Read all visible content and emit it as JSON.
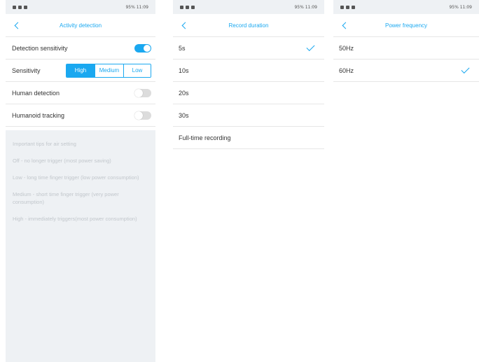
{
  "status_bar": {
    "right_text": "95% 11:09"
  },
  "screen1": {
    "title": "Activity detection",
    "rows": {
      "detection_sensitivity": "Detection sensitivity",
      "sensitivity": "Sensitivity",
      "human_detection": "Human detection",
      "humanoid_tracking": "Humanoid tracking"
    },
    "sensitivity_options": [
      "High",
      "Medium",
      "Low"
    ],
    "selected_sensitivity": "High",
    "toggles": {
      "detection_sensitivity": true,
      "human_detection": false,
      "humanoid_tracking": false
    },
    "tips": [
      "Important tips for air setting",
      "Off - no longer trigger (most power saving)",
      "Low - long time finger trigger (low power consumption)",
      "Medium - short time finger trigger (very power consumption)",
      "High - immediately triggers(most power consumption)"
    ]
  },
  "screen2": {
    "title": "Record duration",
    "options": [
      "5s",
      "10s",
      "20s",
      "30s",
      "Full-time recording"
    ],
    "selected": "5s"
  },
  "screen3": {
    "title": "Power frequency",
    "options": [
      "50Hz",
      "60Hz"
    ],
    "selected": "60Hz"
  },
  "colors": {
    "accent": "#1aa8f0",
    "panel_bg": "#eef1f4",
    "divider": "#e6e6e6"
  }
}
